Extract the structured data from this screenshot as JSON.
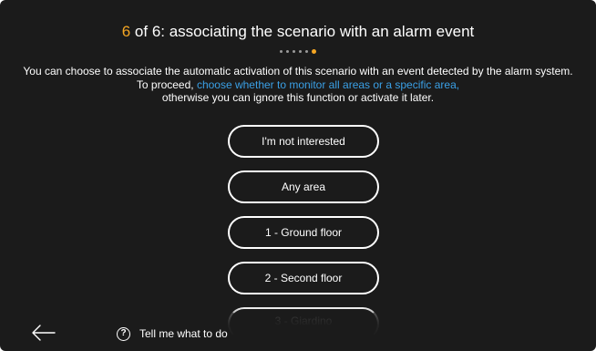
{
  "header": {
    "step_current": "6",
    "title_rest": " of 6: associating the scenario with an alarm event",
    "step_total": 6,
    "step_active": 6
  },
  "description": {
    "text_before": "You can choose to associate the automatic activation of this scenario with an event detected by the alarm system. To proceed, ",
    "link_text": "choose whether to monitor all areas or a specific area,",
    "text_after": " otherwise you can ignore this function or activate it later."
  },
  "options": [
    {
      "label": "I'm not interested"
    },
    {
      "label": "Any area"
    },
    {
      "label": "1 - Ground floor"
    },
    {
      "label": "2 - Second floor"
    },
    {
      "label": "3 - Giardino"
    }
  ],
  "footer": {
    "back_icon": "arrow-left-icon",
    "help_icon": "question-circle-icon",
    "help_glyph": "?",
    "help_label": "Tell me what to do"
  },
  "colors": {
    "background": "#1b1b1b",
    "accent": "#f5a623",
    "link": "#3aa0e6",
    "text": "#ffffff"
  }
}
